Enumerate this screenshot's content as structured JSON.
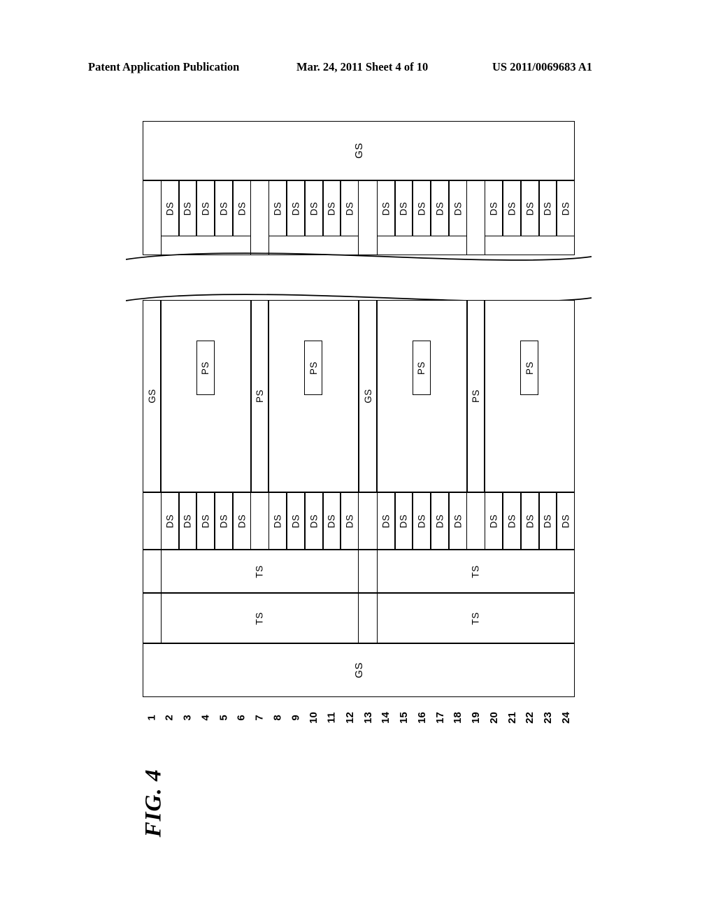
{
  "header": {
    "publication": "Patent Application Publication",
    "date_sheet": "Mar. 24, 2011  Sheet 4 of 10",
    "pub_number": "US 2011/0069683 A1"
  },
  "figure": {
    "label": "FIG. 4",
    "column_numbers": [
      "1",
      "2",
      "3",
      "4",
      "5",
      "6",
      "7",
      "8",
      "9",
      "10",
      "11",
      "12",
      "13",
      "14",
      "15",
      "16",
      "17",
      "18",
      "19",
      "20",
      "21",
      "22",
      "23",
      "24"
    ],
    "labels": {
      "gs": "GS",
      "ps": "PS",
      "ds": "DS",
      "ts": "TS"
    },
    "top_band": {
      "label": "GS",
      "spans_columns": "1-24"
    },
    "top_ds_groups": [
      {
        "columns": "2-6",
        "cells": [
          "DS",
          "DS",
          "DS",
          "DS",
          "DS"
        ]
      },
      {
        "columns": "8-12",
        "cells": [
          "DS",
          "DS",
          "DS",
          "DS",
          "DS"
        ]
      },
      {
        "columns": "14-18",
        "cells": [
          "DS",
          "DS",
          "DS",
          "DS",
          "DS"
        ]
      },
      {
        "columns": "20-24",
        "cells": [
          "DS",
          "DS",
          "DS",
          "DS",
          "DS"
        ]
      }
    ],
    "middle_blocks": [
      {
        "columns": "1",
        "label": "GS",
        "boxed": false
      },
      {
        "columns": "2-6",
        "label": "PS",
        "boxed": true
      },
      {
        "columns": "7",
        "label": "PS",
        "boxed": false
      },
      {
        "columns": "8-12",
        "label": "PS",
        "boxed": true
      },
      {
        "columns": "13",
        "label": "GS",
        "boxed": false
      },
      {
        "columns": "14-18",
        "label": "PS",
        "boxed": true
      },
      {
        "columns": "19",
        "label": "PS",
        "boxed": false
      },
      {
        "columns": "20-24",
        "label": "PS",
        "boxed": true
      }
    ],
    "lower_ds_groups": [
      {
        "columns": "2-6",
        "cells": [
          "DS",
          "DS",
          "DS",
          "DS",
          "DS"
        ]
      },
      {
        "columns": "8-12",
        "cells": [
          "DS",
          "DS",
          "DS",
          "DS",
          "DS"
        ]
      },
      {
        "columns": "14-18",
        "cells": [
          "DS",
          "DS",
          "DS",
          "DS",
          "DS"
        ]
      },
      {
        "columns": "20-24",
        "cells": [
          "DS",
          "DS",
          "DS",
          "DS",
          "DS"
        ]
      }
    ],
    "ts_rows": [
      {
        "row": 1,
        "cells": [
          {
            "columns": "2-12",
            "label": "TS"
          },
          {
            "columns": "14-24",
            "label": "TS"
          }
        ]
      },
      {
        "row": 2,
        "cells": [
          {
            "columns": "2-12",
            "label": "TS"
          },
          {
            "columns": "14-24",
            "label": "TS"
          }
        ]
      }
    ],
    "bottom_band": {
      "label": "GS",
      "spans_columns": "1-24"
    },
    "break_marks": 2
  }
}
